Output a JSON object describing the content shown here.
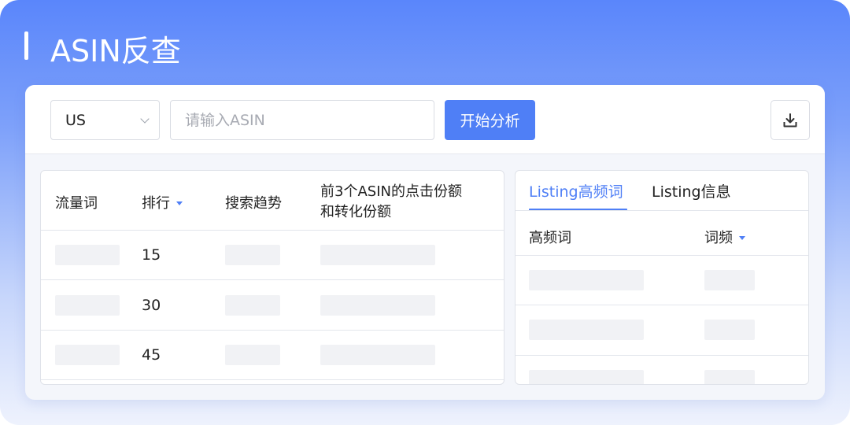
{
  "header": {
    "title": "ASIN反查"
  },
  "toolbar": {
    "marketplace": {
      "selected": "US"
    },
    "asin_input": {
      "placeholder": "请输入ASIN",
      "value": ""
    },
    "analyze_label": "开始分析",
    "download_icon": "download-icon"
  },
  "traffic_table": {
    "columns": {
      "keyword": "流量词",
      "rank": "排行",
      "search_trend": "搜索趋势",
      "click_share_line1": "前3个ASIN的点击份额",
      "click_share_line2": "和转化份额"
    },
    "rows": [
      {
        "rank": "15"
      },
      {
        "rank": "30"
      },
      {
        "rank": "45"
      }
    ]
  },
  "listing_panel": {
    "tabs": [
      {
        "label": "Listing高频词",
        "active": true
      },
      {
        "label": "Listing信息",
        "active": false
      }
    ],
    "columns": {
      "keyword": "高频词",
      "frequency": "词频"
    }
  },
  "colors": {
    "accent": "#4f7ff6",
    "header_gradient_top": "#5a86fb",
    "placeholder_block": "#f1f2f5"
  }
}
